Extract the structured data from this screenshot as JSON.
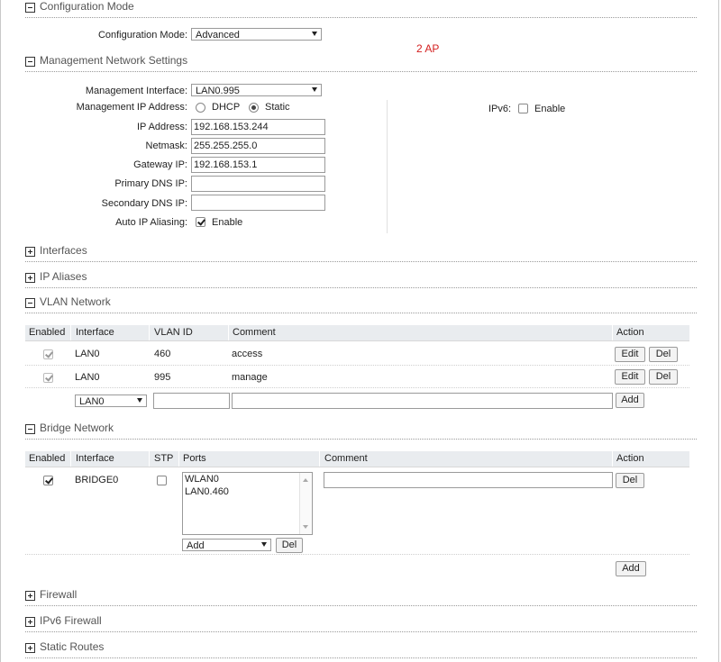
{
  "sections": {
    "config_mode": "Configuration Mode",
    "mgmt": "Management Network Settings",
    "interfaces": "Interfaces",
    "ip_aliases": "IP Aliases",
    "vlan": "VLAN Network",
    "bridge": "Bridge Network",
    "firewall": "Firewall",
    "ipv6_firewall": "IPv6 Firewall",
    "static_routes": "Static Routes"
  },
  "config": {
    "label": "Configuration Mode:",
    "value": "Advanced",
    "note": "2 AP"
  },
  "mgmt": {
    "iface_label": "Management Interface:",
    "iface_value": "LAN0.995",
    "ipaddr_mode_label": "Management IP Address:",
    "dhcp": "DHCP",
    "static": "Static",
    "ip_label": "IP Address:",
    "ip": "192.168.153.244",
    "mask_label": "Netmask:",
    "mask": "255.255.255.0",
    "gw_label": "Gateway IP:",
    "gw": "192.168.153.1",
    "dns1_label": "Primary DNS IP:",
    "dns1": "",
    "dns2_label": "Secondary DNS IP:",
    "dns2": "",
    "alias_label": "Auto IP Aliasing:",
    "alias_enable": "Enable",
    "ipv6_label": "IPv6:",
    "ipv6_enable": "Enable"
  },
  "vlan": {
    "headers": [
      "Enabled",
      "Interface",
      "VLAN ID",
      "Comment",
      "Action"
    ],
    "rows": [
      {
        "interface": "LAN0",
        "vlan_id": "460",
        "comment": "access",
        "enabled": true
      },
      {
        "interface": "LAN0",
        "vlan_id": "995",
        "comment": "manage",
        "enabled": true
      }
    ],
    "new_interface": "LAN0",
    "edit": "Edit",
    "del": "Del",
    "add": "Add"
  },
  "bridge": {
    "headers": [
      "Enabled",
      "Interface",
      "STP",
      "Ports",
      "Comment",
      "Action"
    ],
    "row": {
      "interface": "BRIDGE0",
      "enabled": true,
      "stp": false,
      "ports": [
        "WLAN0",
        "LAN0.460"
      ],
      "comment": ""
    },
    "port_select": "Add",
    "del": "Del",
    "add": "Add"
  }
}
